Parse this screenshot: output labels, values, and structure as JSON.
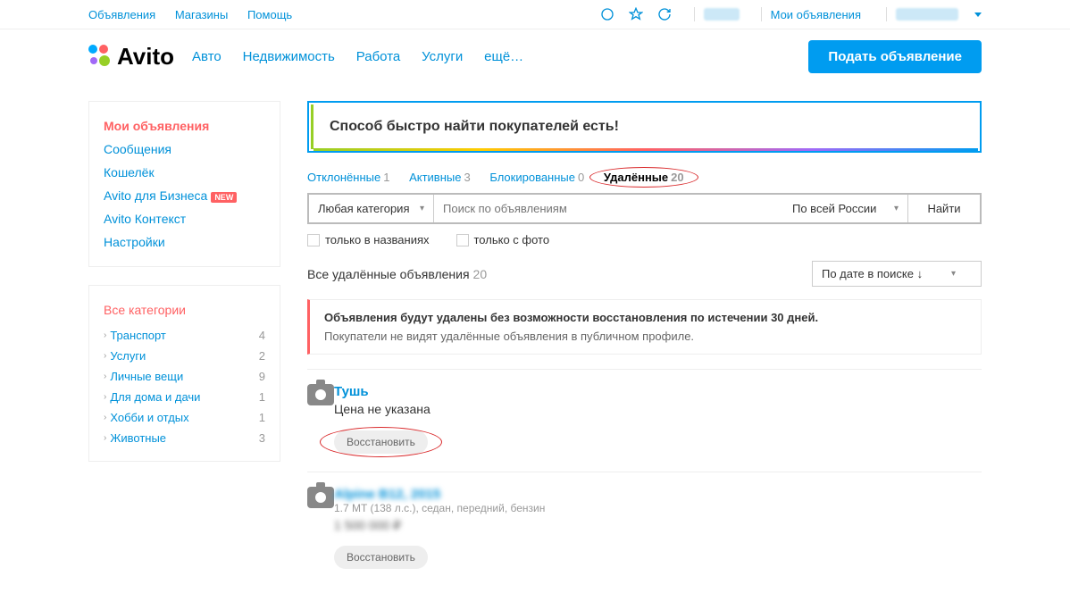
{
  "topbar": {
    "left": [
      "Объявления",
      "Магазины",
      "Помощь"
    ],
    "my_ads": "Мои объявления"
  },
  "header": {
    "logo_text": "Avito",
    "nav": [
      "Авто",
      "Недвижимость",
      "Работа",
      "Услуги",
      "ещё…"
    ],
    "post_button": "Подать объявление"
  },
  "sidebar_menu": {
    "items": [
      {
        "label": "Мои объявления",
        "active": true
      },
      {
        "label": "Сообщения"
      },
      {
        "label": "Кошелёк"
      },
      {
        "label": "Avito для Бизнеса",
        "badge": "NEW"
      },
      {
        "label": "Avito Контекст"
      },
      {
        "label": "Настройки"
      }
    ]
  },
  "sidebar_cats": {
    "head": "Все категории",
    "items": [
      {
        "label": "Транспорт",
        "count": 4
      },
      {
        "label": "Услуги",
        "count": 2
      },
      {
        "label": "Личные вещи",
        "count": 9
      },
      {
        "label": "Для дома и дачи",
        "count": 1
      },
      {
        "label": "Хобби и отдых",
        "count": 1
      },
      {
        "label": "Животные",
        "count": 3
      }
    ]
  },
  "banner": {
    "title": "Способ быстро найти покупателей есть!"
  },
  "tabs": [
    {
      "label": "Отклонённые",
      "count": 1
    },
    {
      "label": "Активные",
      "count": 3
    },
    {
      "label": "Блокированные",
      "count": 0
    },
    {
      "label": "Удалённые",
      "count": 20,
      "active": true,
      "circled": true
    }
  ],
  "search": {
    "category": "Любая категория",
    "placeholder": "Поиск по объявлениям",
    "region": "По всей России",
    "button": "Найти"
  },
  "filters": {
    "titles_only": "только в названиях",
    "photo_only": "только с фото"
  },
  "list_header": {
    "title": "Все удалённые объявления",
    "count": 20,
    "sort": "По дате в поиске ↓"
  },
  "warning": {
    "line1": "Объявления будут удалены без возможности восстановления по истечении 30 дней.",
    "line2": "Покупатели не видят удалённые объявления в публичном профиле."
  },
  "listings": [
    {
      "title": "Тушь",
      "price": "Цена не указана",
      "restore": "Восстановить",
      "circled": true
    },
    {
      "title_blur": "Alpine B12, 2015",
      "subtitle": "1.7 MT (138 л.с.), седан, передний, бензин",
      "price_blur": "1 500 000 ₽",
      "restore": "Восстановить"
    }
  ]
}
